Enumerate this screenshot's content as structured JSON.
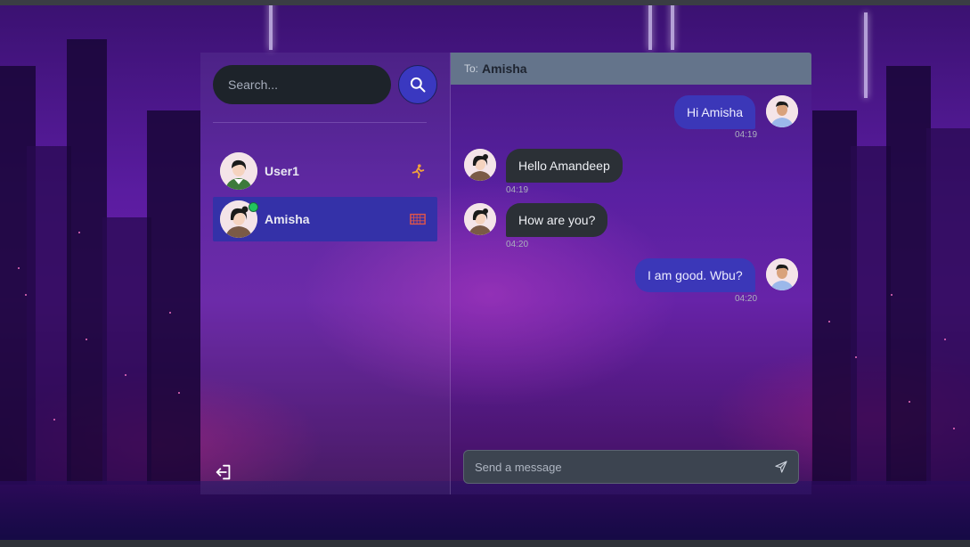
{
  "sidebar": {
    "search": {
      "placeholder": "Search..."
    },
    "conversations": [
      {
        "name": "User1",
        "emoji": "🏃",
        "online": false,
        "active": false
      },
      {
        "name": "Amisha",
        "emoji": "🥅",
        "online": true,
        "active": true
      }
    ]
  },
  "chat": {
    "header": {
      "to_label": "To:",
      "recipient": "Amisha"
    },
    "messages": [
      {
        "text": "Hi Amisha",
        "time": "04:19",
        "from_me": true
      },
      {
        "text": "Hello Amandeep",
        "time": "04:19",
        "from_me": false
      },
      {
        "text": "How are you?",
        "time": "04:20",
        "from_me": false
      },
      {
        "text": "I am good. Wbu?",
        "time": "04:20",
        "from_me": true
      }
    ],
    "composer": {
      "placeholder": "Send a message"
    }
  },
  "colors": {
    "accent": "#3b37b8",
    "header_bg": "#64748b",
    "incoming_bubble": "#2b3036",
    "online": "#22c55e"
  },
  "icons": {
    "search": "search-icon",
    "logout": "logout-icon",
    "send": "send-icon"
  }
}
